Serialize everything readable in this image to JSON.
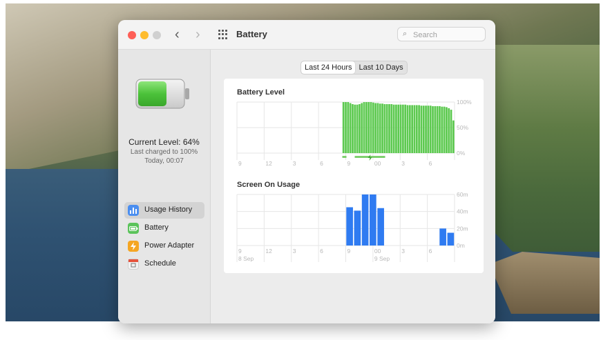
{
  "window": {
    "title": "Battery"
  },
  "search": {
    "placeholder": "Search"
  },
  "sidebar": {
    "current_level": "Current Level: 64%",
    "last_charged": "Last charged to 100%",
    "last_charged_time": "Today, 00:07",
    "battery_level_fraction": 0.64,
    "items": [
      {
        "label": "Usage History",
        "icon": "bar-chart-icon",
        "color": "#4a8ef0",
        "active": true
      },
      {
        "label": "Battery",
        "icon": "battery-icon",
        "color": "#5ac35a",
        "active": false
      },
      {
        "label": "Power Adapter",
        "icon": "lightning-icon",
        "color": "#f5a623",
        "active": false
      },
      {
        "label": "Schedule",
        "icon": "calendar-icon",
        "color": "#e9e9e9",
        "active": false
      }
    ]
  },
  "tabs": [
    {
      "label": "Last 24 Hours",
      "selected": true
    },
    {
      "label": "Last 10 Days",
      "selected": false
    }
  ],
  "colors": {
    "battery_green": "#5cc94f",
    "screen_blue": "#2f7bf1",
    "grid": "#e3e3e3"
  },
  "chart_data": [
    {
      "type": "bar",
      "title": "Battery Level",
      "x_tick_labels": [
        "9",
        "12",
        "3",
        "6",
        "9",
        "00",
        "3",
        "6"
      ],
      "y_tick_labels": [
        "100%",
        "50%",
        "0%"
      ],
      "ylim": [
        0,
        100
      ],
      "values": [
        null,
        null,
        null,
        null,
        null,
        null,
        null,
        null,
        null,
        null,
        null,
        null,
        null,
        null,
        null,
        null,
        null,
        null,
        null,
        null,
        null,
        null,
        null,
        null,
        null,
        null,
        null,
        null,
        null,
        null,
        null,
        null,
        null,
        null,
        null,
        null,
        null,
        null,
        null,
        null,
        null,
        null,
        null,
        null,
        null,
        null,
        100,
        100,
        100,
        98,
        96,
        95,
        95,
        96,
        98,
        100,
        100,
        100,
        100,
        99,
        98,
        98,
        97,
        97,
        96,
        96,
        96,
        96,
        95,
        95,
        95,
        95,
        95,
        95,
        94,
        94,
        94,
        94,
        94,
        94,
        93,
        93,
        93,
        93,
        93,
        92,
        92,
        92,
        92,
        91,
        91,
        90,
        88,
        85,
        64
      ],
      "charging_indicator": "lightning-icon"
    },
    {
      "type": "bar",
      "title": "Screen On Usage",
      "x_tick_labels": [
        "9",
        "12",
        "3",
        "6",
        "9",
        "00",
        "3",
        "6"
      ],
      "x_sub_labels": [
        "8 Sep",
        "9 Sep"
      ],
      "y_tick_labels": [
        "60m",
        "40m",
        "20m",
        "0m"
      ],
      "ylim": [
        0,
        60
      ],
      "values": [
        0,
        0,
        0,
        0,
        0,
        0,
        0,
        0,
        0,
        0,
        0,
        0,
        0,
        0,
        45,
        41,
        60,
        60,
        44,
        0,
        0,
        0,
        0,
        0,
        0,
        0,
        20,
        15
      ]
    }
  ]
}
